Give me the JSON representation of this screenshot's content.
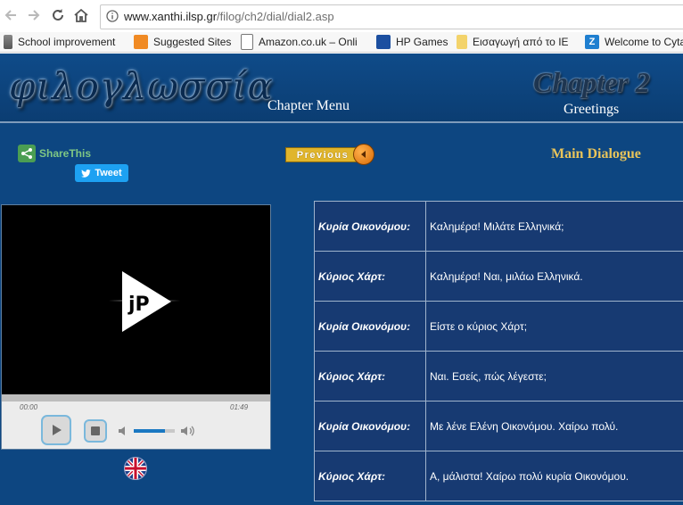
{
  "browser": {
    "url_host": "www.xanthi.ilsp.gr",
    "url_path": "/filog/ch2/dial/dial2.asp",
    "bookmarks": [
      {
        "label": "School improvement",
        "icon": "document-icon"
      },
      {
        "label": "Suggested Sites",
        "icon": "suggested-sites-icon"
      },
      {
        "label": "Amazon.co.uk – Onli",
        "icon": "page-icon"
      },
      {
        "label": "HP Games",
        "icon": "hp-icon"
      },
      {
        "label": "Εισαγωγή από το IE",
        "icon": "folder-icon"
      },
      {
        "label": "Welcome to Cyta",
        "icon": "z-icon"
      }
    ]
  },
  "header": {
    "logo": "φιλογλωσσία",
    "chapter_menu": "Chapter Menu",
    "chapter_title": "Chapter 2",
    "chapter_subtitle": "Greetings"
  },
  "toolbar": {
    "sharethis": "ShareThis",
    "tweet": "Tweet",
    "previous": "Previous",
    "section_title": "Main Dialogue"
  },
  "player": {
    "current_time": "00:00",
    "duration": "01:49",
    "volume": 0.75,
    "progress": 0
  },
  "dialogue": [
    {
      "speaker": "Κυρία Οικονόμου:",
      "line": "Καλημέρα! Μιλάτε Ελληνικά;"
    },
    {
      "speaker": "Κύριος Χάρτ:",
      "line": "Καλημέρα! Ναι, μιλάω Ελληνικά."
    },
    {
      "speaker": "Κυρία Οικονόμου:",
      "line": "Είστε ο κύριος Χάρτ;"
    },
    {
      "speaker": "Κύριος Χάρτ:",
      "line": "Ναι. Εσείς, πώς λέγεστε;"
    },
    {
      "speaker": "Κυρία Οικονόμου:",
      "line": "Με λένε Ελένη Οικονόμου. Χαίρω πολύ."
    },
    {
      "speaker": "Κύριος Χάρτ:",
      "line": "Α, μάλιστα! Χαίρω πολύ κυρία Οικονόμου."
    }
  ]
}
